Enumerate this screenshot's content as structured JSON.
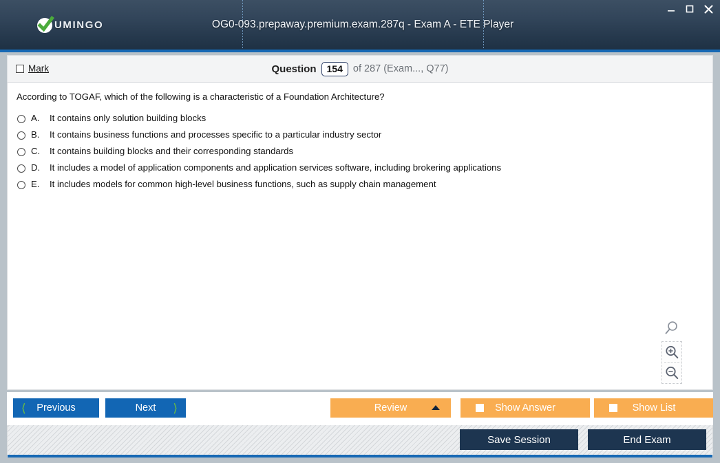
{
  "window": {
    "title": "OG0-093.prepaway.premium.exam.287q - Exam A - ETE Player",
    "logo_text": "UMINGO",
    "logo_icon": "green-check-circle-icon",
    "controls": {
      "minimize": "minimize-icon",
      "maximize": "maximize-icon",
      "close": "close-icon"
    }
  },
  "question_header": {
    "mark_label_prefix": "",
    "mark_label": "Mark",
    "mark_checked": false,
    "question_word": "Question",
    "question_number": "154",
    "of_text": "of 287 (Exam..., Q77)"
  },
  "question": {
    "text": "According to TOGAF, which of the following is a characteristic of a Foundation Architecture?",
    "options": [
      {
        "letter": "A.",
        "text": "It contains only solution building blocks",
        "selected": false
      },
      {
        "letter": "B.",
        "text": "It contains business functions and processes specific to a particular industry sector",
        "selected": false
      },
      {
        "letter": "C.",
        "text": "It contains building blocks and their corresponding standards",
        "selected": false
      },
      {
        "letter": "D.",
        "text": "It includes a model of application components and application services software, including brokering applications",
        "selected": false
      },
      {
        "letter": "E.",
        "text": "It includes models for common high-level business functions, such as supply chain management",
        "selected": false
      }
    ]
  },
  "zoom_tools": {
    "magnifier": "magnifier-icon",
    "zoom_in": "zoom-in-icon",
    "zoom_out": "zoom-out-icon"
  },
  "footer": {
    "previous_label": "Previous",
    "next_label": "Next",
    "review_label": "Review",
    "show_answer_label": "Show Answer",
    "show_list_label": "Show List",
    "save_session_label": "Save Session",
    "end_exam_label": "End Exam"
  },
  "colors": {
    "titlebar_dark": "#24374b",
    "accent_blue": "#1769b5",
    "button_blue": "#1266b4",
    "chevron_green": "#6cbf3f",
    "button_orange": "#f9ad51",
    "button_dark_navy": "#1d3550"
  }
}
